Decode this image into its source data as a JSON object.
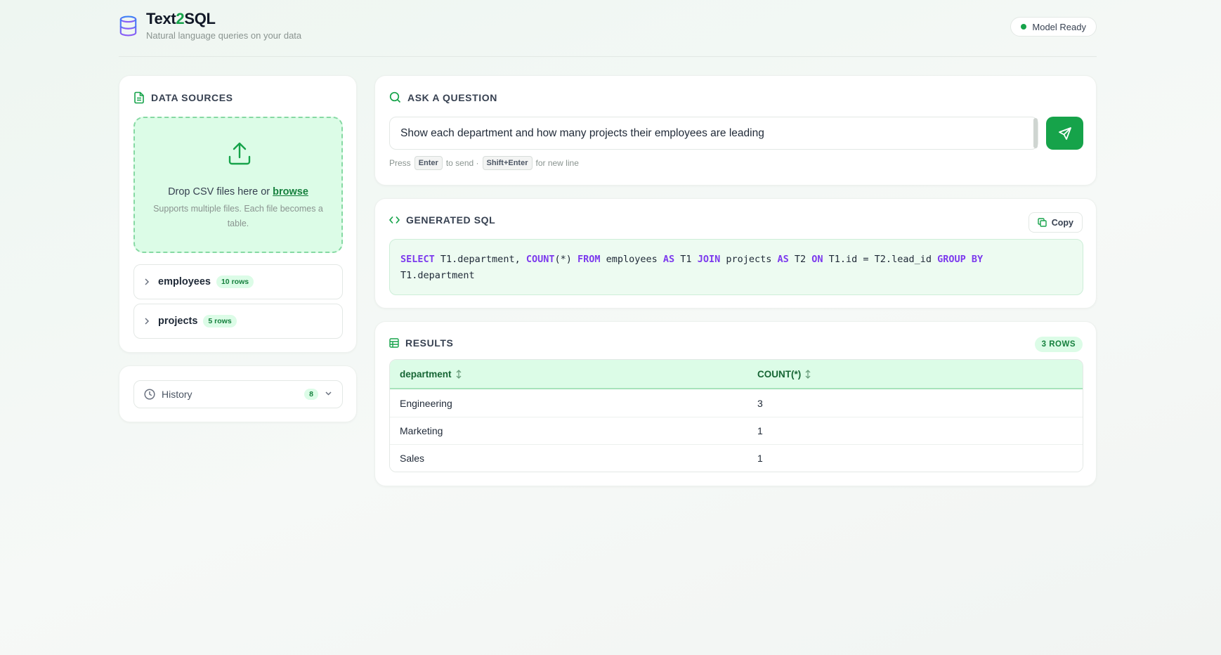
{
  "header": {
    "title_main": "Text",
    "title_accent": "2",
    "title_end": "SQL",
    "subtitle": "Natural language queries on your data",
    "status": "Model Ready",
    "status_color": "#16a34a"
  },
  "data_sources": {
    "title": "DATA SOURCES",
    "drop_text": "Drop CSV files here or",
    "browse_label": "browse",
    "drop_hint": "Supports multiple files. Each file becomes a table.",
    "tables": [
      {
        "name": "employees",
        "rows": "10 rows"
      },
      {
        "name": "projects",
        "rows": "5 rows"
      }
    ]
  },
  "history": {
    "label": "History",
    "count": "8"
  },
  "ask": {
    "title": "ASK A QUESTION",
    "question": "Show each department and how many projects their employees are leading",
    "hint_press": "Press",
    "hint_key_send": "Enter",
    "hint_to_send": "to send ·",
    "hint_key_newline": "Shift+Enter",
    "hint_for_newline": "for new line"
  },
  "sql": {
    "title": "GENERATED SQL",
    "copy_label": "Copy",
    "tokens": [
      {
        "t": "SELECT",
        "kw": true
      },
      {
        "t": " T1.department, ",
        "kw": false
      },
      {
        "t": "COUNT",
        "kw": true
      },
      {
        "t": "(*) ",
        "kw": false
      },
      {
        "t": "FROM",
        "kw": true
      },
      {
        "t": " employees ",
        "kw": false
      },
      {
        "t": "AS",
        "kw": true
      },
      {
        "t": " T1 ",
        "kw": false
      },
      {
        "t": "JOIN",
        "kw": true
      },
      {
        "t": " projects ",
        "kw": false
      },
      {
        "t": "AS",
        "kw": true
      },
      {
        "t": " T2 ",
        "kw": false
      },
      {
        "t": "ON",
        "kw": true
      },
      {
        "t": " T1.id = T2.lead_id ",
        "kw": false
      },
      {
        "t": "GROUP BY",
        "kw": true
      },
      {
        "t": "\nT1.department",
        "kw": false
      }
    ]
  },
  "results": {
    "title": "RESULTS",
    "row_count": "3 ROWS",
    "columns": [
      "department",
      "COUNT(*)"
    ],
    "rows": [
      [
        "Engineering",
        "3"
      ],
      [
        "Marketing",
        "1"
      ],
      [
        "Sales",
        "1"
      ]
    ]
  },
  "colors": {
    "accent": "#16a34a",
    "keyword": "#7c3aed"
  }
}
